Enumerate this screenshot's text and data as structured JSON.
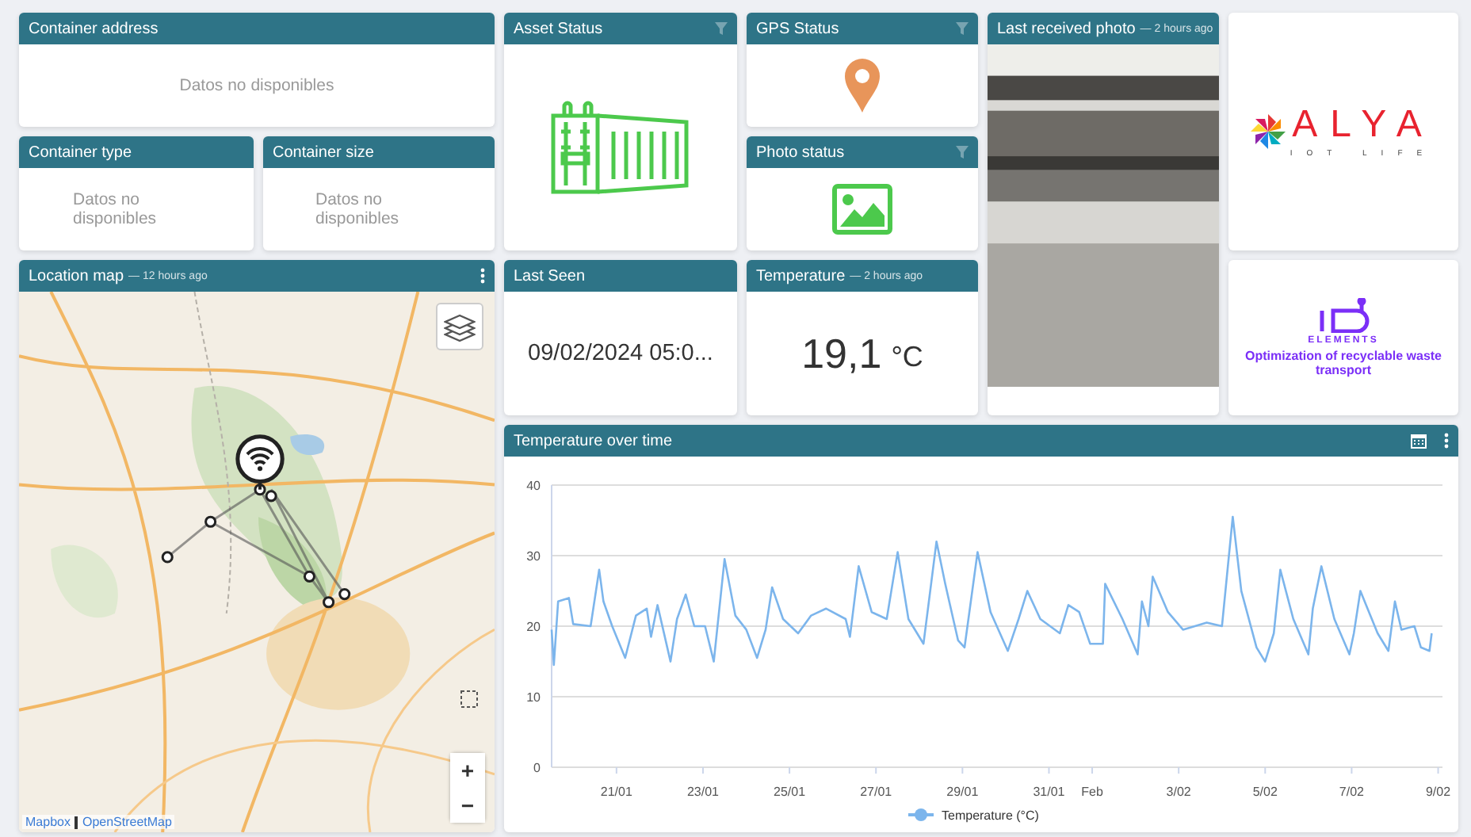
{
  "container_address": {
    "title": "Container address",
    "message": "Datos no disponibles"
  },
  "container_type": {
    "title": "Container type",
    "message": "Datos no disponibles"
  },
  "container_size": {
    "title": "Container size",
    "message": "Datos no disponibles"
  },
  "asset_status": {
    "title": "Asset Status"
  },
  "gps_status": {
    "title": "GPS Status"
  },
  "photo_status": {
    "title": "Photo status"
  },
  "last_photo": {
    "title": "Last received photo",
    "age": "— 2 hours ago",
    "kind": "picture"
  },
  "logo_alya": {
    "name": "ALYA",
    "tagline": "IOT LIFE"
  },
  "logo_elements": {
    "name": "ELEMENTS",
    "caption": "Optimization of recyclable waste transport"
  },
  "location_map": {
    "title": "Location map",
    "age": "— 12 hours ago",
    "attribution": [
      "Mapbox",
      "OpenStreetMap"
    ],
    "zoom_in": "+",
    "zoom_out": "−"
  },
  "last_seen": {
    "title": "Last Seen",
    "value": "09/02/2024 05:0..."
  },
  "temperature": {
    "title": "Temperature",
    "age": "— 2 hours ago",
    "value": "19,1",
    "unit": "°C"
  },
  "temperature_chart": {
    "title": "Temperature over time",
    "chart_data": {
      "type": "line",
      "grid": true,
      "xlim": [
        "2024-01-19T12:00",
        "2024-02-09T02:24"
      ],
      "ylim": [
        0,
        40
      ],
      "yticks": [
        0,
        10,
        20,
        30,
        40
      ],
      "xticks": [
        {
          "value": "2024-01-21",
          "label": "21/01"
        },
        {
          "value": "2024-01-23",
          "label": "23/01"
        },
        {
          "value": "2024-01-25",
          "label": "25/01"
        },
        {
          "value": "2024-01-27",
          "label": "27/01"
        },
        {
          "value": "2024-01-29",
          "label": "29/01"
        },
        {
          "value": "2024-01-31",
          "label": "31/01"
        },
        {
          "value": "2024-02-01",
          "label": "Feb"
        },
        {
          "value": "2024-02-03",
          "label": "3/02"
        },
        {
          "value": "2024-02-05",
          "label": "5/02"
        },
        {
          "value": "2024-02-07",
          "label": "7/02"
        },
        {
          "value": "2024-02-09",
          "label": "9/02"
        }
      ],
      "x": [
        "2024-01-19T12:00",
        "2024-01-19T13:12",
        "2024-01-19T15:36",
        "2024-01-19T21:36",
        "2024-01-20T00:00",
        "2024-01-20T09:36",
        "2024-01-20T14:24",
        "2024-01-20T16:48",
        "2024-01-20T21:36",
        "2024-01-21T04:48",
        "2024-01-21T10:48",
        "2024-01-21T16:48",
        "2024-01-21T19:12",
        "2024-01-21T22:48",
        "2024-01-22T06:00",
        "2024-01-22T09:36",
        "2024-01-22T14:24",
        "2024-01-22T19:12",
        "2024-01-23T01:12",
        "2024-01-23T06:00",
        "2024-01-23T12:00",
        "2024-01-23T18:00",
        "2024-01-24T00:00",
        "2024-01-24T06:00",
        "2024-01-24T10:48",
        "2024-01-24T14:24",
        "2024-01-24T20:24",
        "2024-01-25T04:48",
        "2024-01-25T12:00",
        "2024-01-25T20:24",
        "2024-01-26T07:12",
        "2024-01-26T09:36",
        "2024-01-26T14:24",
        "2024-01-26T21:36",
        "2024-01-27T06:00",
        "2024-01-27T12:00",
        "2024-01-27T18:00",
        "2024-01-28T02:24",
        "2024-01-28T09:36",
        "2024-01-28T14:24",
        "2024-01-28T21:36",
        "2024-01-29T01:12",
        "2024-01-29T08:24",
        "2024-01-29T15:36",
        "2024-01-30T01:12",
        "2024-01-30T07:12",
        "2024-01-30T12:00",
        "2024-01-30T19:12",
        "2024-01-31T06:00",
        "2024-01-31T10:48",
        "2024-01-31T16:48",
        "2024-01-31T22:48",
        "2024-02-01T06:00",
        "2024-02-01T07:12",
        "2024-02-01T16:48",
        "2024-02-02T01:12",
        "2024-02-02T03:36",
        "2024-02-02T07:12",
        "2024-02-02T09:36",
        "2024-02-02T18:00",
        "2024-02-03T02:24",
        "2024-02-03T15:36",
        "2024-02-04T00:00",
        "2024-02-04T06:00",
        "2024-02-04T10:48",
        "2024-02-04T19:12",
        "2024-02-05T00:00",
        "2024-02-05T04:48",
        "2024-02-05T08:24",
        "2024-02-05T15:36",
        "2024-02-06T00:00",
        "2024-02-06T02:24",
        "2024-02-06T07:12",
        "2024-02-06T14:24",
        "2024-02-06T22:48",
        "2024-02-07T01:12",
        "2024-02-07T04:48",
        "2024-02-07T14:24",
        "2024-02-07T20:24",
        "2024-02-08T00:00",
        "2024-02-08T03:36",
        "2024-02-08T10:48",
        "2024-02-08T14:24",
        "2024-02-08T19:12",
        "2024-02-08T20:24"
      ],
      "series": [
        {
          "name": "Temperature (°C)",
          "color": "#7cb5ec",
          "values": [
            19.5,
            14.5,
            23.5,
            24,
            20.3,
            20,
            28,
            23.5,
            20,
            15.5,
            21.5,
            22.5,
            18.5,
            23,
            15,
            21,
            24.5,
            20,
            20,
            15,
            29.5,
            21.5,
            19.5,
            15.5,
            19.5,
            25.5,
            21,
            19,
            21.5,
            22.5,
            21,
            18.5,
            28.5,
            22,
            21,
            30.5,
            21,
            17.5,
            32,
            26,
            18,
            17,
            30.5,
            22,
            16.5,
            21,
            25,
            21,
            19,
            23,
            22,
            17.5,
            17.5,
            26,
            21,
            16,
            23.5,
            20,
            27,
            22,
            19.5,
            20.5,
            20,
            35.5,
            25,
            17,
            15,
            19,
            28,
            21,
            16,
            22.5,
            28.5,
            21,
            16,
            19,
            25,
            19,
            16.5,
            23.5,
            19.5,
            20,
            17,
            16.5,
            19
          ]
        }
      ]
    }
  }
}
